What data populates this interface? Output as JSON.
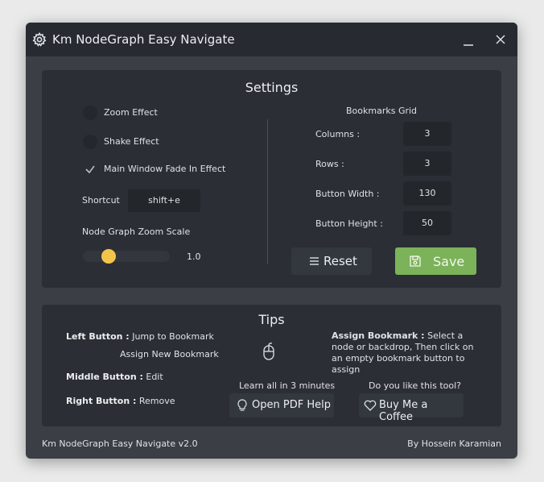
{
  "window": {
    "title": "Km NodeGraph Easy Navigate",
    "minimize_glyph": "_",
    "close_glyph": "✕"
  },
  "settings": {
    "title": "Settings",
    "zoom_effect": {
      "label": "Zoom Effect",
      "checked": false
    },
    "shake_effect": {
      "label": "Shake Effect",
      "checked": false
    },
    "fade_in": {
      "label": "Main Window Fade In Effect",
      "checked": true
    },
    "shortcut": {
      "label": "Shortcut",
      "value": "shift+e"
    },
    "zoom_scale": {
      "label": "Node Graph Zoom Scale",
      "value": "1.0",
      "position": 0.25
    },
    "bookmarks_grid": {
      "title": "Bookmarks Grid",
      "fields": [
        {
          "label": "Columns :",
          "value": "3"
        },
        {
          "label": "Rows :",
          "value": "3"
        },
        {
          "label": "Button Width :",
          "value": "130"
        },
        {
          "label": "Button Height :",
          "value": "50"
        }
      ]
    },
    "reset_label": "Reset",
    "save_label": "Save"
  },
  "tips": {
    "title": "Tips",
    "left_button_key": "Left Button :",
    "left_button_value": "Jump to Bookmark",
    "left_button_extra": "Assign New Bookmark",
    "middle_button_key": "Middle Button :",
    "middle_button_value": "Edit",
    "right_button_key": "Right Button :",
    "right_button_value": "Remove",
    "assign_key": "Assign Bookmark :",
    "assign_value": "Select a node or backdrop, Then click on an empty bookmark button to assign",
    "learn_caption": "Learn all in 3 minutes",
    "pdf_label": "Open PDF Help",
    "like_caption": "Do you like this tool?",
    "coffee_label": "Buy Me a Coffee"
  },
  "footer": {
    "version": "Km NodeGraph Easy Navigate v2.0",
    "author": "By Hossein Karamian"
  },
  "colors": {
    "accent_save": "#7cb25a",
    "slider_handle": "#f2c54a"
  }
}
